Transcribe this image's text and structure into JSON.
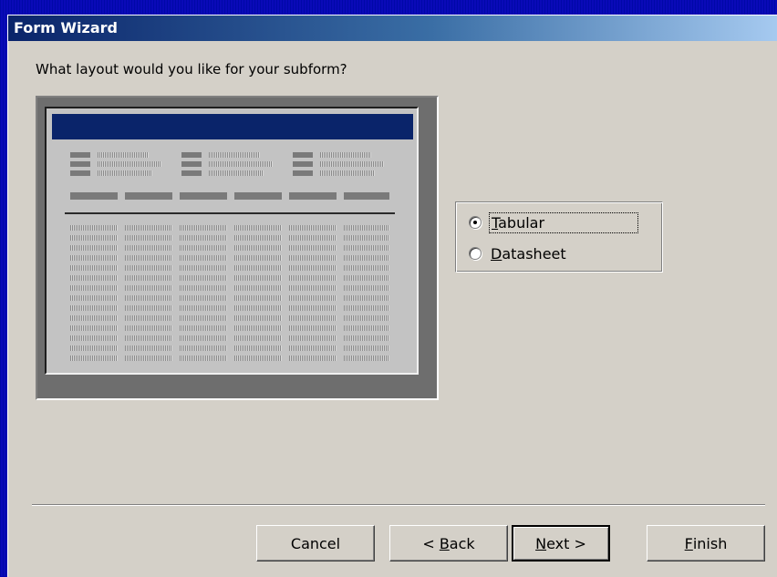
{
  "window": {
    "title": "Form Wizard"
  },
  "prompt": "What layout would you like for your subform?",
  "layout_options": [
    {
      "label_underlined": "T",
      "label_rest": "abular",
      "selected": true
    },
    {
      "label_underlined": "D",
      "label_rest": "atasheet",
      "selected": false
    }
  ],
  "buttons": {
    "cancel": {
      "pre": "Cancel",
      "u": "",
      "post": ""
    },
    "back": {
      "pre": "< ",
      "u": "B",
      "post": "ack"
    },
    "next": {
      "pre": "",
      "u": "N",
      "post": "ext >"
    },
    "finish": {
      "pre": "",
      "u": "F",
      "post": "inish"
    }
  },
  "colors": {
    "title_start": "#0a246a",
    "title_end": "#a6caf0",
    "dialog_bg": "#d4d0c8",
    "desktop": "#0000b4"
  }
}
